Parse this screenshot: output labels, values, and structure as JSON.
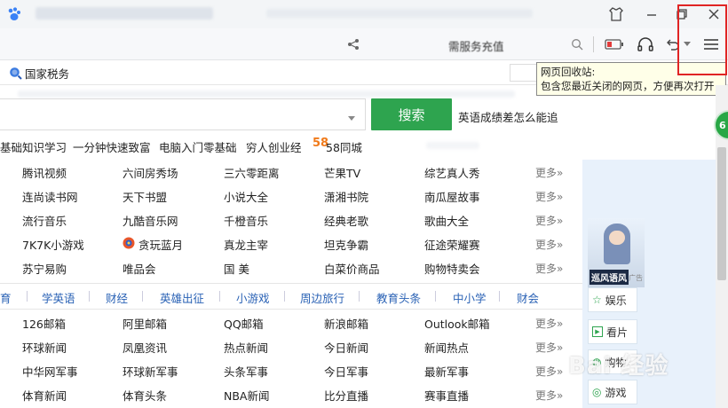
{
  "toolbar": {
    "address_text": "需服务充值",
    "menu_tooltip_title": "网页回收站:",
    "menu_tooltip_desc": "包含您最近关闭的网页，方便再次打开"
  },
  "bookmarks": {
    "item1": "国家税务"
  },
  "search": {
    "button_label": "搜索",
    "suggestion": "英语成绩差怎么能追"
  },
  "hot_links": [
    "基础知识学习",
    "一分钟快速致富",
    "电脑入门零基础",
    "穷人创业经",
    "58同城"
  ],
  "hot_badge": "58",
  "grid_top": [
    [
      "腾讯视频",
      "六间房秀场",
      "三六零距离",
      "芒果TV",
      "综艺真人秀"
    ],
    [
      "连尚读书网",
      "天下书盟",
      "小说大全",
      "潇湘书院",
      "南瓜屋故事"
    ],
    [
      "流行音乐",
      "九酷音乐网",
      "千橙音乐",
      "经典老歌",
      "歌曲大全"
    ],
    [
      "7K7K小游戏",
      "贪玩蓝月",
      "真龙主宰",
      "坦克争霸",
      "征途荣耀赛"
    ],
    [
      "苏宁易购",
      "唯品会",
      "国 美",
      "白菜价商品",
      "购物特卖会"
    ]
  ],
  "categories": [
    "育",
    "学英语",
    "财经",
    "英雄出征",
    "小游戏",
    "周边旅行",
    "教育头条",
    "中小学",
    "财会"
  ],
  "grid_bottom": [
    [
      "126邮箱",
      "阿里邮箱",
      "QQ邮箱",
      "新浪邮箱",
      "Outlook邮箱"
    ],
    [
      "环球新闻",
      "凤凰资讯",
      "热点新闻",
      "今日新闻",
      "新闻热点"
    ],
    [
      "中华网军事",
      "环球新军事",
      "头条军事",
      "今日军事",
      "最新军事"
    ],
    [
      "体育新闻",
      "体育头条",
      "NBA新闻",
      "比分直播",
      "赛事直播"
    ]
  ],
  "more_label": "更多»",
  "side_panel": {
    "banner_text": "巡风语风",
    "ad_label": "广告",
    "items": [
      "娱乐",
      "看片",
      "购物",
      "游戏"
    ]
  },
  "side_badge": "6",
  "watermark": "Bai 经验"
}
